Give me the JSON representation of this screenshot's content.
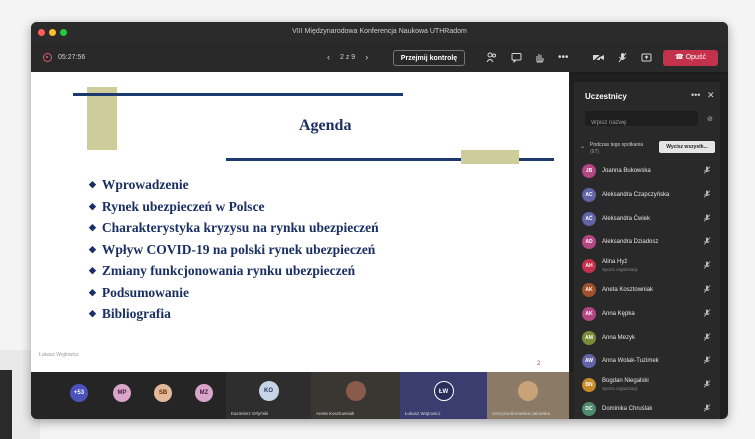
{
  "window": {
    "title": "VIII Międzynarodowa Konferencja Naukowa UTHRadom",
    "dot_colors": [
      "#ff5f57",
      "#febc2e",
      "#28c840"
    ]
  },
  "toolbar": {
    "timer": "05:27:56",
    "page_indicator": "2 z 9",
    "take_control_label": "Przejmij kontrolę",
    "leave_label": "Opuść",
    "accent": "#c4314b"
  },
  "slide": {
    "title": "Agenda",
    "items": [
      "Wprowadzenie",
      "Rynek ubezpieczeń w Polsce",
      "Charakterystyka kryzysu na rynku ubezpieczeń",
      "Wpływ COVID-19 na polski rynek ubezpieczeń",
      "Zmiany funkcjonowania rynku ubezpieczeń",
      "Podsumowanie",
      "Bibliografia"
    ],
    "author": "Łukasz Wojtowicz",
    "page_number": "2",
    "bullet": "◆"
  },
  "participants": {
    "header": "Uczestnicy",
    "more": "•••",
    "close": "✕",
    "search_placeholder": "Wpisz nazwę",
    "section_label": "Podczas tego spotkania",
    "section_count": "(67)",
    "mute_all_label": "Wycisz wszystk...",
    "list": [
      {
        "initials": "JB",
        "name": "Joanna Bukowska",
        "sub": "",
        "color": "#b24782"
      },
      {
        "initials": "AC",
        "name": "Aleksandra Czapczyńska",
        "sub": "",
        "color": "#6264a7"
      },
      {
        "initials": "AĆ",
        "name": "Aleksandra Ćwiek",
        "sub": "",
        "color": "#6264a7"
      },
      {
        "initials": "AD",
        "name": "Aleksandra Dziadosz",
        "sub": "",
        "color": "#b24782"
      },
      {
        "initials": "AH",
        "name": "Alina Hyż",
        "sub": "Spoza organizacji",
        "color": "#c4314b"
      },
      {
        "initials": "AK",
        "name": "Aneta Kosztowniak",
        "sub": "",
        "color": "#a0522d"
      },
      {
        "initials": "AK",
        "name": "Anna Kępka",
        "sub": "",
        "color": "#b24782"
      },
      {
        "initials": "AM",
        "name": "Anna Mezyk",
        "sub": "",
        "color": "#7a8c3a"
      },
      {
        "initials": "AW",
        "name": "Anna Wolak-Tuzimek",
        "sub": "",
        "color": "#6264a7"
      },
      {
        "initials": "BN",
        "name": "Bogdan Niegalski",
        "sub": "Spoza organizacji",
        "color": "#c58b2b"
      },
      {
        "initials": "DC",
        "name": "Dominika Chruślak",
        "sub": "",
        "color": "#4e8a6e"
      }
    ]
  },
  "strip": {
    "overflow": "+53",
    "avatars": [
      {
        "initials": "MP",
        "color": "#d9a6c9",
        "text": "#4a2240"
      },
      {
        "initials": "SB",
        "color": "#e3b99a",
        "text": "#5a3010"
      },
      {
        "initials": "MZ",
        "color": "#d9a6c9",
        "text": "#4a2240"
      }
    ],
    "tiles": [
      {
        "initials": "KO",
        "name": "Kazimierz Orlyński",
        "bg": "#2e2e2e",
        "avbg": "#c7d3e6",
        "avtext": "#2a3a5a"
      },
      {
        "initials": "",
        "name": "Aneta Kosztowniak",
        "bg": "#3a3632",
        "avbg": "#8a5a4a",
        "avtext": "#fff"
      },
      {
        "initials": "ŁW",
        "name": "Łukasz Wojtowicz",
        "bg": "#3b3d6e",
        "avbg": "#2b2e5a",
        "avtext": "#fff"
      },
      {
        "initials": "",
        "name": "Grażyna Borowska-Jalowska",
        "bg": "#8a7a66",
        "avbg": "#c9a27a",
        "avtext": "#fff"
      }
    ]
  }
}
